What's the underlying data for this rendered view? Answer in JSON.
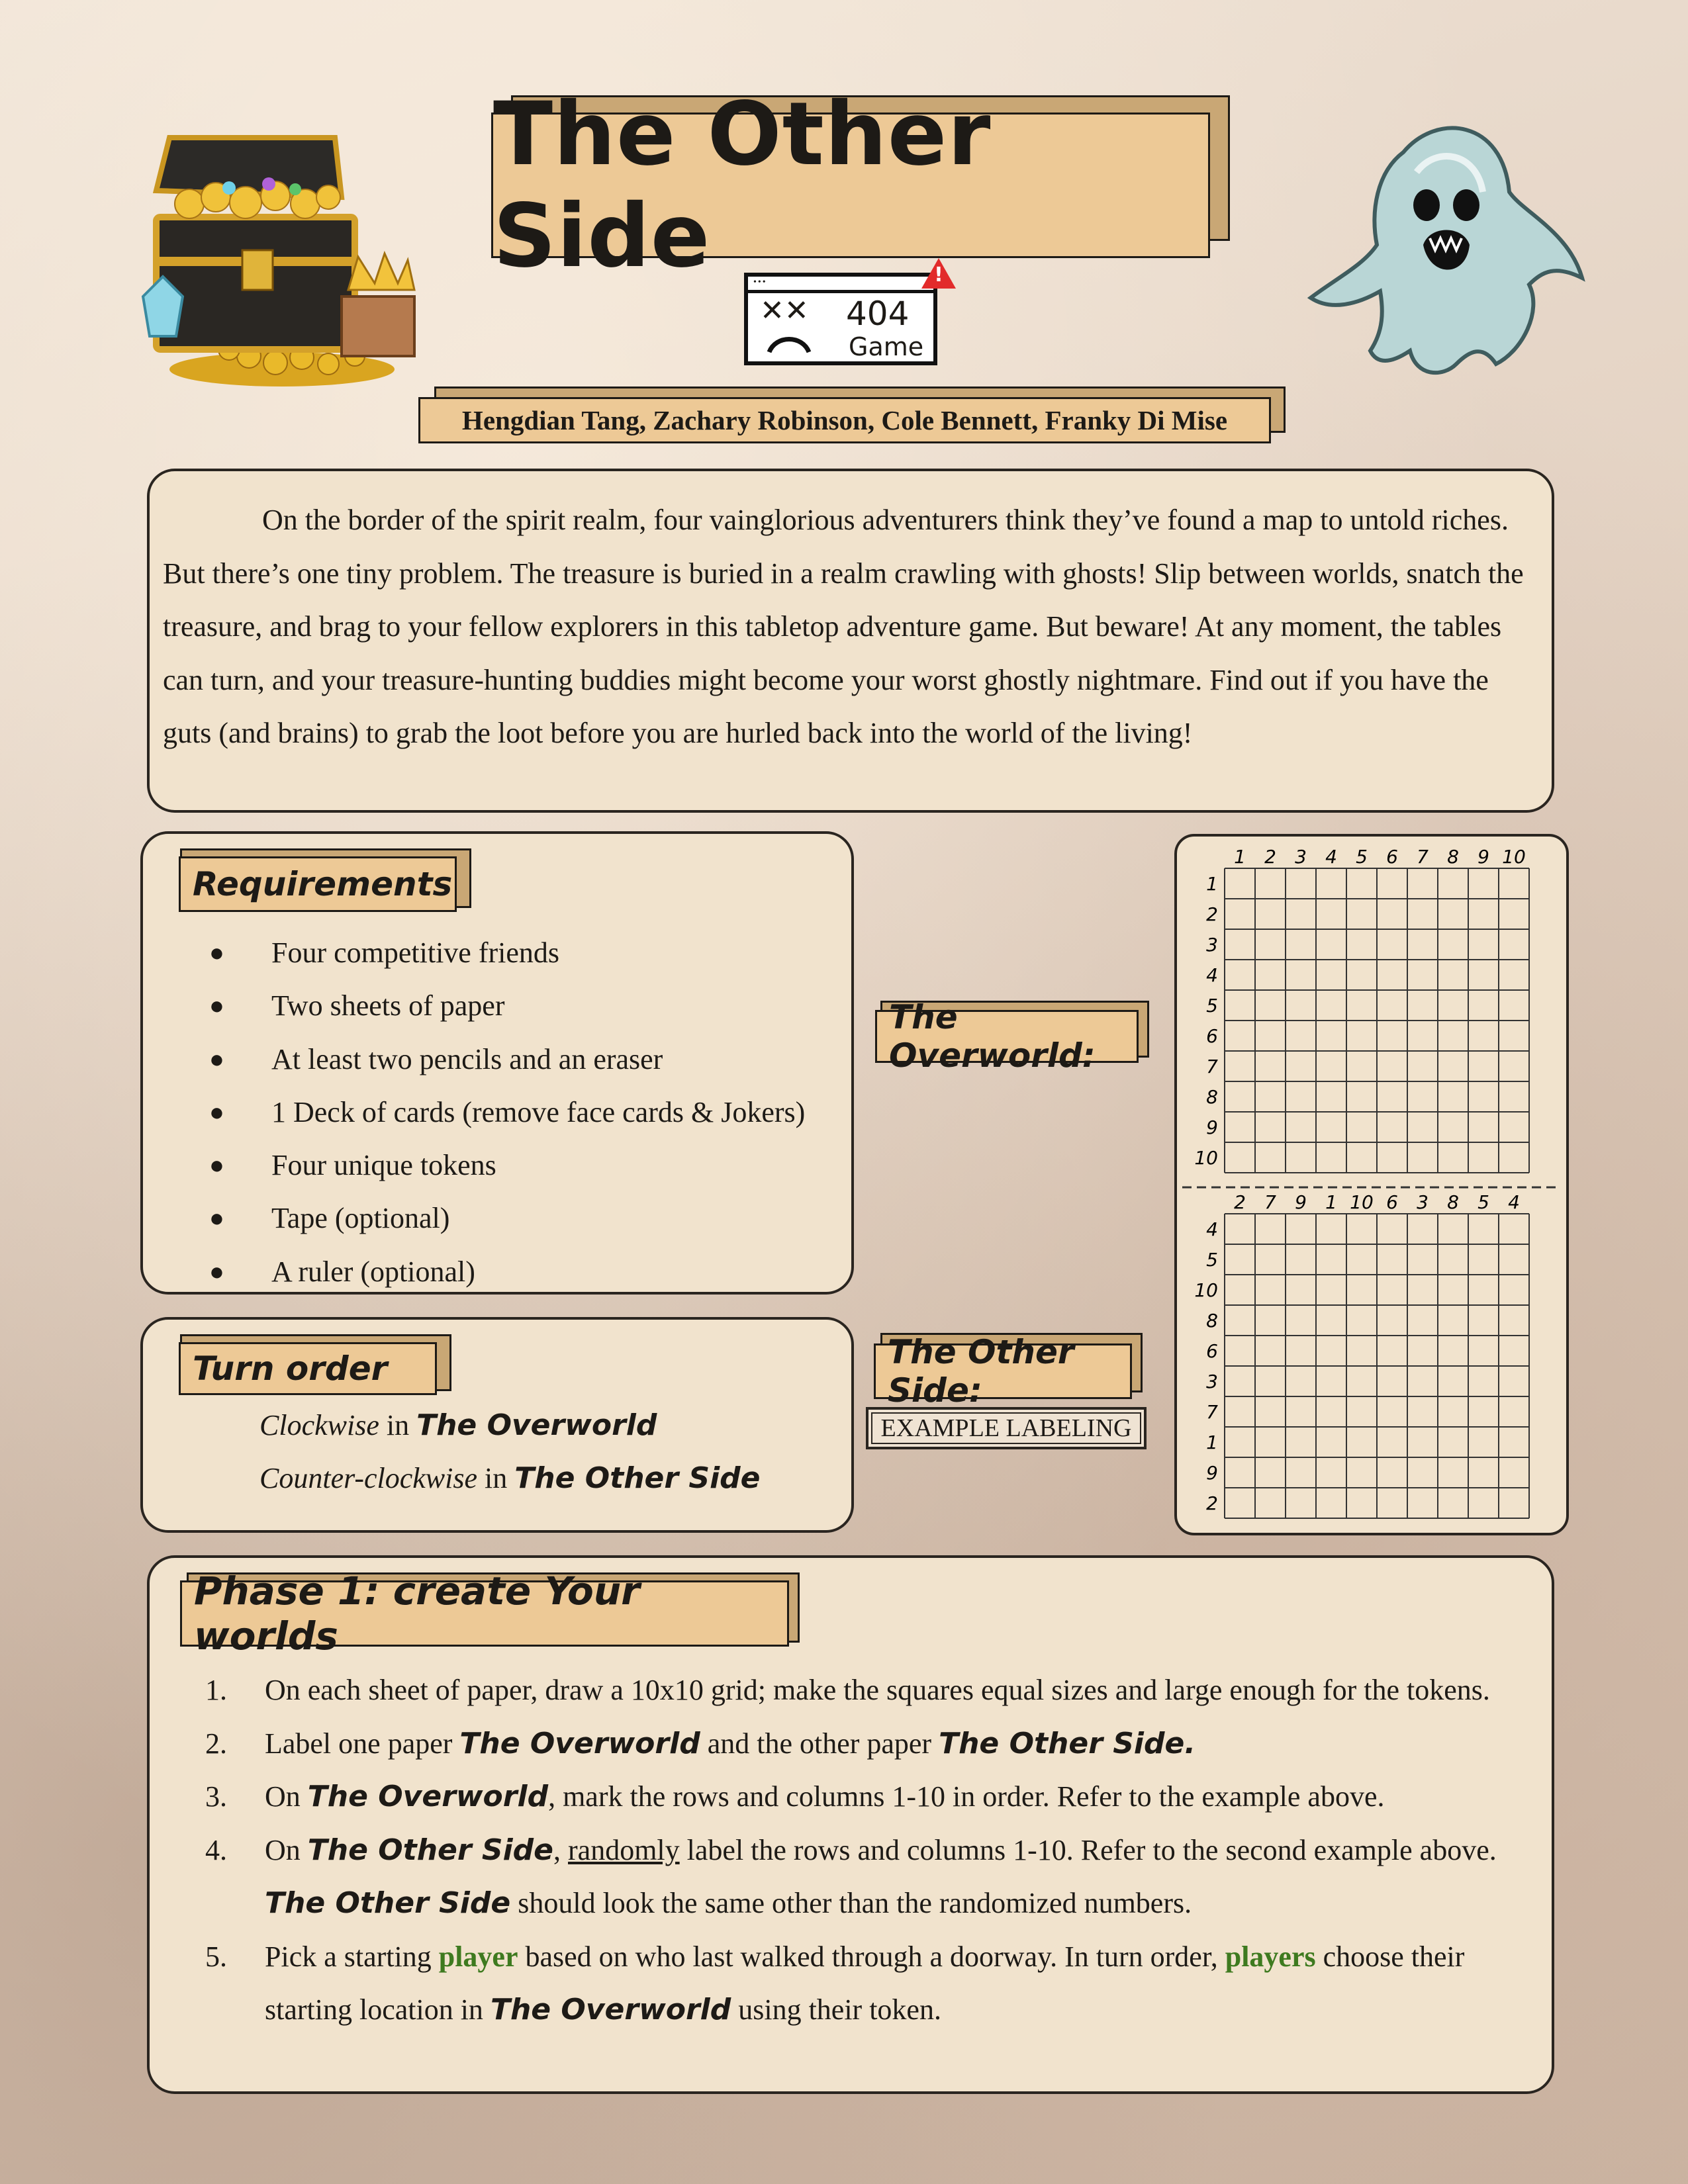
{
  "title": "The Other Side",
  "badge": {
    "number": "404",
    "word": "Game",
    "face": "✕✕",
    "window_dots": "•••",
    "alert": "!"
  },
  "authors": "Hengdian Tang, Zachary Robinson, Cole Bennett, Franky Di Mise",
  "intro": "On the border of the spirit realm, four vainglorious adventurers think they’ve found a map to untold riches. But there’s one tiny problem. The treasure is buried in a realm crawling with ghosts! Slip between worlds, snatch the treasure, and brag to your fellow explorers in this tabletop adventure game. But beware! At any moment, the tables can turn, and your treasure-hunting buddies might become your worst ghostly nightmare. Find out if you have the guts (and brains) to grab the loot before you are hurled back into the world of the living!",
  "requirements": {
    "heading": "Requirements",
    "bullet": "●",
    "items": [
      "Four competitive friends",
      "Two sheets of paper",
      "At least two pencils and an eraser",
      "1 Deck of cards (remove face cards & Jokers)",
      "Four unique tokens",
      "Tape (optional)",
      "A ruler  (optional)"
    ]
  },
  "turn_order": {
    "heading": "Turn order",
    "lines": [
      {
        "direction": "Clockwise",
        "joiner": "in",
        "world": "The Overworld"
      },
      {
        "direction": "Counter-clockwise",
        "joiner": "in",
        "world": "The Other Side"
      }
    ]
  },
  "labels": {
    "overworld": "The Overworld:",
    "other_side": "The Other Side:",
    "example": "EXAMPLE LABELING"
  },
  "overworld_grid": {
    "columns": [
      "1",
      "2",
      "3",
      "4",
      "5",
      "6",
      "7",
      "8",
      "9",
      "10"
    ],
    "rows": [
      "1",
      "2",
      "3",
      "4",
      "5",
      "6",
      "7",
      "8",
      "9",
      "10"
    ]
  },
  "other_side_grid": {
    "columns": [
      "2",
      "7",
      "9",
      "1",
      "10",
      "6",
      "3",
      "8",
      "5",
      "4"
    ],
    "rows": [
      "4",
      "5",
      "10",
      "8",
      "6",
      "3",
      "7",
      "1",
      "9",
      "2"
    ]
  },
  "phase1": {
    "heading": "Phase 1: create Your worlds",
    "steps": [
      {
        "num": "1.",
        "parts": [
          {
            "t": "On each sheet of paper, draw a 10x10 grid; make the squares equal sizes and large enough for the tokens."
          }
        ]
      },
      {
        "num": "2.",
        "parts": [
          {
            "t": "Label one paper "
          },
          {
            "h": "The Overworld"
          },
          {
            "t": " and the other paper "
          },
          {
            "h": "The Other Side."
          }
        ]
      },
      {
        "num": "3.",
        "parts": [
          {
            "t": "On "
          },
          {
            "h": "The Overworld"
          },
          {
            "t": ", mark the rows and columns 1-10 in order. Refer to the example above."
          }
        ]
      },
      {
        "num": "4.",
        "parts": [
          {
            "t": "On "
          },
          {
            "h": "The Other Side"
          },
          {
            "t": ", "
          },
          {
            "u": "randomly"
          },
          {
            "t": " label the rows and columns 1-10. Refer to the second example above. "
          },
          {
            "h": "The Other Side"
          },
          {
            "t": " should look the same other than the randomized numbers."
          }
        ]
      },
      {
        "num": "5.",
        "parts": [
          {
            "t": "Pick a starting "
          },
          {
            "g": "player"
          },
          {
            "t": " based on who last walked through a doorway. In turn order, "
          },
          {
            "g": "players"
          },
          {
            "t": " choose their starting location in "
          },
          {
            "h": "The Overworld"
          },
          {
            "t": " using their token."
          }
        ]
      }
    ]
  },
  "colors": {
    "tab": "#edc996",
    "panel": "#f1e3cd",
    "highlight_green": "#3e7a1f"
  },
  "icons": [
    "treasure-chest-icon",
    "ghost-icon",
    "error-404-icon"
  ]
}
